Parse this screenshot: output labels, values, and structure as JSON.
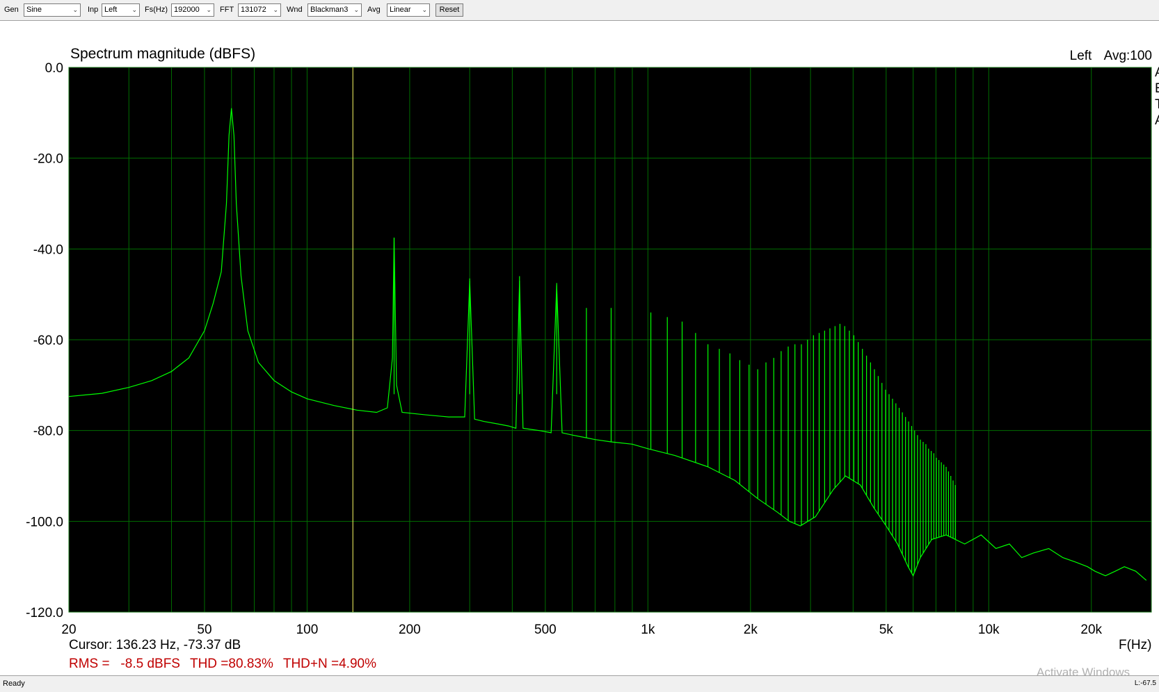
{
  "toolbar": {
    "gen_label": "Gen",
    "gen_value": "Sine",
    "inp_label": "Inp",
    "inp_value": "Left",
    "fs_label": "Fs(Hz)",
    "fs_value": "192000",
    "fft_label": "FFT",
    "fft_value": "131072",
    "wnd_label": "Wnd",
    "wnd_value": "Blackman3",
    "avg_label": "Avg",
    "avg_value": "Linear",
    "reset_label": "Reset"
  },
  "plot": {
    "title": "Spectrum magnitude (dBFS)",
    "channel": "Left",
    "average": "Avg:100",
    "side_glyphs": [
      "A",
      "E",
      "T",
      "A"
    ],
    "cursor": "Cursor: 136.23 Hz, -73.37 dB",
    "rms": "RMS =   -8.5 dBFS",
    "thd": "THD =80.83%",
    "thdn": "THD+N =4.90%",
    "x_axis_label": "F(Hz)"
  },
  "status": {
    "text": "Ready",
    "right": "L:-67.5",
    "watermark": "Activate Windows"
  },
  "colors": {
    "trace": "#00ff00",
    "grid": "#006e00",
    "cursor": "#ffff66",
    "background": "#000000",
    "stats": "#c00000"
  },
  "chart_data": {
    "type": "line",
    "x_scale": "log",
    "xlim": [
      20,
      30000
    ],
    "ylim": [
      -120,
      0
    ],
    "x_ticks": [
      20,
      50,
      100,
      200,
      500,
      1000,
      2000,
      5000,
      10000,
      20000
    ],
    "x_tick_labels": [
      "20",
      "50",
      "100",
      "200",
      "500",
      "1k",
      "2k",
      "5k",
      "10k",
      "20k"
    ],
    "y_ticks": [
      0,
      -20,
      -40,
      -60,
      -80,
      -100,
      -120
    ],
    "y_tick_labels": [
      "0.0",
      "-20.0",
      "-40.0",
      "-60.0",
      "-80.0",
      "-100.0",
      "-120.0"
    ],
    "cursor_x": 136.23,
    "fundamental_hz": 60,
    "series": [
      {
        "color": "#00ff00",
        "x": [
          20,
          25,
          30,
          35,
          40,
          45,
          50,
          53,
          56,
          58,
          59,
          60,
          61,
          62,
          64,
          67,
          72,
          80,
          90,
          100,
          120,
          140,
          160,
          172,
          178,
          180,
          183,
          190,
          220,
          260,
          290,
          300,
          310,
          330,
          360,
          390,
          410,
          420,
          430,
          480,
          520,
          540,
          560,
          600,
          650,
          700,
          780,
          900,
          1000,
          1200,
          1500,
          1800,
          2100,
          2400,
          2600,
          2800,
          3100,
          3500,
          3800,
          4200,
          4600,
          5000,
          5400,
          5800,
          6000,
          6300,
          6800,
          7500,
          8500,
          9500,
          10500,
          11500,
          12500,
          13500,
          15000,
          16500,
          18000,
          19500,
          20500,
          22000,
          23500,
          25000,
          27000,
          29000
        ],
        "y": [
          -72.5,
          -71.8,
          -70.5,
          -69,
          -67,
          -64,
          -58,
          -52,
          -45,
          -30,
          -15,
          -9,
          -15,
          -30,
          -46,
          -58,
          -65,
          -69,
          -71.5,
          -73,
          -74.5,
          -75.5,
          -76,
          -75,
          -64,
          -37.5,
          -70,
          -76,
          -76.5,
          -77,
          -77,
          -47,
          -77.5,
          -78,
          -78.5,
          -79,
          -79.5,
          -47,
          -79.5,
          -80,
          -80.5,
          -48,
          -80.5,
          -81,
          -81.5,
          -82,
          -82.5,
          -83,
          -84,
          -85.5,
          -88,
          -91,
          -95,
          -98,
          -100,
          -101,
          -99,
          -93,
          -90,
          -92,
          -97,
          -101,
          -105,
          -110,
          -112,
          -108,
          -104,
          -103,
          -105,
          -103,
          -106,
          -105,
          -108,
          -107,
          -106,
          -108,
          -109,
          -110,
          -111,
          -112,
          -111,
          -110,
          -111,
          -113
        ]
      }
    ],
    "harmonic_peaks_hz": [
      180,
      300,
      420,
      540,
      660,
      780,
      1020,
      1140,
      1260,
      1380,
      1500,
      1620,
      1740,
      1860,
      1980,
      2100,
      2220,
      2340,
      2460,
      2580,
      2700,
      2820,
      2940,
      3060,
      3180,
      3300,
      3420,
      3540,
      3660,
      3780,
      3900,
      4020,
      4140,
      4260,
      4380,
      4500,
      4620,
      4740,
      4860,
      4980,
      5100,
      5220,
      5340,
      5460,
      5580,
      5700,
      5820,
      5940,
      6060,
      6180,
      6300,
      6420,
      6540,
      6660,
      6780,
      6900,
      7020,
      7140,
      7260,
      7380,
      7500,
      7620,
      7740,
      7860,
      7980
    ],
    "harmonic_peaks_db": [
      -37.5,
      -46.5,
      -46,
      -47.5,
      -53,
      -53,
      -54,
      -55,
      -56,
      -58.5,
      -61,
      -62,
      -63,
      -64.5,
      -65.5,
      -66.5,
      -65,
      -64,
      -62.5,
      -61.5,
      -61,
      -61,
      -60,
      -59,
      -58.5,
      -58,
      -57.5,
      -57,
      -56.5,
      -57,
      -58,
      -59,
      -60.5,
      -62,
      -63.5,
      -65,
      -66.5,
      -68,
      -69.5,
      -71,
      -72,
      -73,
      -74,
      -75,
      -76,
      -77,
      -78,
      -79,
      -80,
      -81,
      -82,
      -82.5,
      -83,
      -84,
      -84.5,
      -85,
      -86,
      -86.5,
      -87,
      -87.5,
      -88,
      -89,
      -90,
      -91,
      -92
    ]
  }
}
